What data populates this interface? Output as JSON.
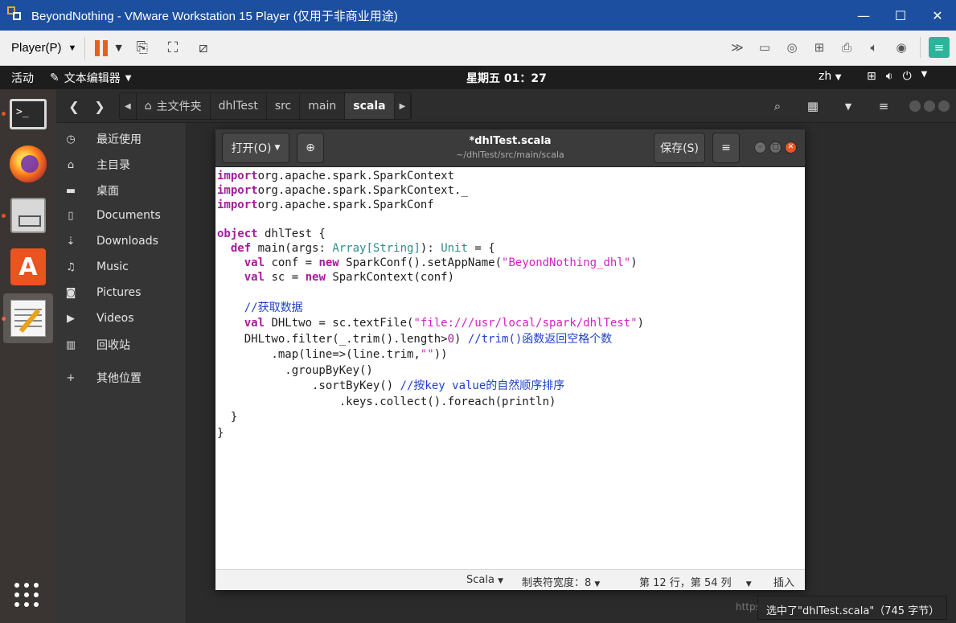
{
  "vmware": {
    "title": "BeyondNothing - VMware Workstation 15 Player (仅用于非商业用途)",
    "player_menu": "Player(P)",
    "window_min": "—",
    "window_max": "☐",
    "window_close": "✕"
  },
  "ubuntu_panel": {
    "activities": "活动",
    "app_menu": "文本编辑器",
    "clock": "星期五 01：27",
    "lang": "zh"
  },
  "files": {
    "breadcrumbs": [
      "主文件夹",
      "dhlTest",
      "src",
      "main",
      "scala"
    ],
    "sidebar": [
      {
        "icon": "clock-icon",
        "glyph": "◷",
        "label": "最近使用"
      },
      {
        "icon": "home-icon",
        "glyph": "⌂",
        "label": "主目录"
      },
      {
        "icon": "folder-icon",
        "glyph": "▬",
        "label": "桌面"
      },
      {
        "icon": "document-icon",
        "glyph": "▯",
        "label": "Documents"
      },
      {
        "icon": "download-icon",
        "glyph": "⇣",
        "label": "Downloads"
      },
      {
        "icon": "music-icon",
        "glyph": "♫",
        "label": "Music"
      },
      {
        "icon": "camera-icon",
        "glyph": "◙",
        "label": "Pictures"
      },
      {
        "icon": "video-icon",
        "glyph": "▶",
        "label": "Videos"
      },
      {
        "icon": "trash-icon",
        "glyph": "▥",
        "label": "回收站"
      },
      {
        "icon": "plus-icon",
        "glyph": "+",
        "label": "其他位置"
      }
    ]
  },
  "gedit": {
    "open_label": "打开(O)",
    "save_label": "保存(S)",
    "title": "*dhlTest.scala",
    "subtitle": "~/dhlTest/src/main/scala",
    "code_lines": [
      [
        [
          "kw",
          "import"
        ],
        [
          "",
          "org.apache.spark.SparkContext"
        ]
      ],
      [
        [
          "kw",
          "import"
        ],
        [
          "",
          "org.apache.spark.SparkContext._"
        ]
      ],
      [
        [
          "kw",
          "import"
        ],
        [
          "",
          "org.apache.spark.SparkConf"
        ]
      ],
      [],
      [
        [
          "kw",
          "object"
        ],
        [
          "",
          " dhlTest {"
        ]
      ],
      [
        [
          "",
          "  "
        ],
        [
          "kw",
          "def"
        ],
        [
          "",
          " main(args: "
        ],
        [
          "ty",
          "Array[String]"
        ],
        [
          "",
          "): "
        ],
        [
          "ty",
          "Unit"
        ],
        [
          "",
          " = {"
        ]
      ],
      [
        [
          "",
          "    "
        ],
        [
          "kw",
          "val"
        ],
        [
          "",
          " conf = "
        ],
        [
          "kw",
          "new"
        ],
        [
          "",
          " SparkConf().setAppName("
        ],
        [
          "str",
          "\"BeyondNothing_dhl\""
        ],
        [
          "",
          ")"
        ]
      ],
      [
        [
          "",
          "    "
        ],
        [
          "kw",
          "val"
        ],
        [
          "",
          " sc = "
        ],
        [
          "kw",
          "new"
        ],
        [
          "",
          " SparkContext(conf)"
        ]
      ],
      [],
      [
        [
          "",
          "    "
        ],
        [
          "cm",
          "//获取数据"
        ]
      ],
      [
        [
          "",
          "    "
        ],
        [
          "kw",
          "val"
        ],
        [
          "",
          " DHLtwo = sc.textFile("
        ],
        [
          "str",
          "\"file:///usr/local/spark/dhlTest\""
        ],
        [
          "",
          ")"
        ]
      ],
      [
        [
          "",
          "    DHLtwo.filter(_.trim().length>"
        ],
        [
          "nm",
          "0"
        ],
        [
          "",
          ") "
        ],
        [
          "cm",
          "//trim()函数返回空格个数"
        ]
      ],
      [
        [
          "",
          "        .map(line=>(line.trim,"
        ],
        [
          "str",
          "\"\""
        ],
        [
          "",
          "))"
        ]
      ],
      [
        [
          "",
          "          .groupByKey()"
        ]
      ],
      [
        [
          "",
          "              .sortByKey() "
        ],
        [
          "cm",
          "//按key value的自然顺序排序"
        ]
      ],
      [
        [
          "",
          "                  .keys.collect().foreach(println)"
        ]
      ],
      [
        [
          "",
          "  }"
        ]
      ],
      [
        [
          "",
          "}"
        ]
      ]
    ],
    "status": {
      "language": "Scala",
      "tab_width": "制表符宽度：8",
      "position": "第 12 行，第 54 列",
      "mode": "插入"
    }
  },
  "toast": "选中了\"dhlTest.scala\"（745 字节）",
  "watermark": "https://blog.csdn.net/"
}
